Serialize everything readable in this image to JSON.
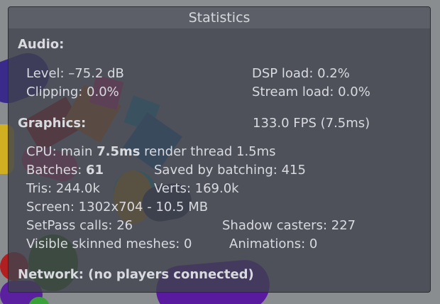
{
  "window": {
    "title": "Statistics"
  },
  "audio": {
    "heading": "Audio:",
    "level": "Level: –75.2 dB",
    "clipping": "Clipping: 0.0%",
    "dsp_load": "DSP load: 0.2%",
    "stream_load": "Stream load: 0.0%"
  },
  "graphics": {
    "heading": "Graphics:",
    "fps": "133.0 FPS (7.5ms)",
    "cpu_prefix": "CPU: main ",
    "cpu_main": "7.5ms",
    "cpu_suffix": "  render thread 1.5ms",
    "batches_prefix": "Batches: ",
    "batches": "61",
    "saved_by_batching": "Saved by batching: 415",
    "tris": "Tris: 244.0k",
    "verts": "Verts: 169.0k",
    "screen": "Screen: 1302x704 - 10.5 MB",
    "setpass": "SetPass calls: 26",
    "shadow_casters": "Shadow casters: 227",
    "skinned_meshes": "Visible skinned meshes: 0",
    "animations": "Animations: 0"
  },
  "network": {
    "label": "Network: (no players connected)"
  }
}
